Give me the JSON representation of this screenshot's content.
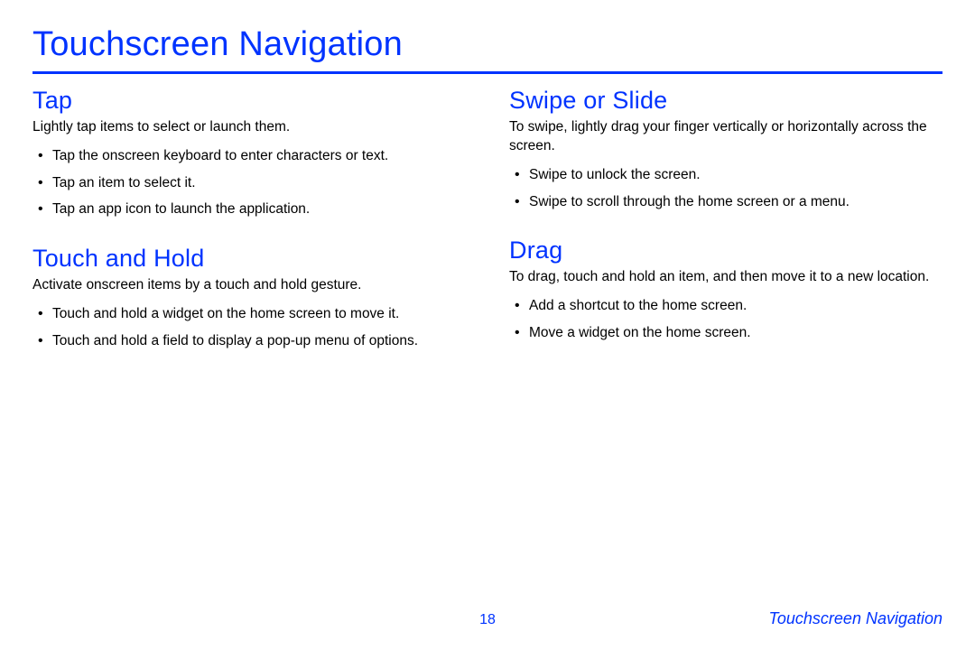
{
  "page": {
    "title": "Touchscreen Navigation",
    "number": "18",
    "footer_label": "Touchscreen Navigation"
  },
  "sections": {
    "tap": {
      "title": "Tap",
      "intro": "Lightly tap items to select or launch them.",
      "bullets": [
        "Tap the onscreen keyboard to enter characters or text.",
        "Tap an item to select it.",
        "Tap an app icon to launch the application."
      ]
    },
    "touch_hold": {
      "title": "Touch and Hold",
      "intro": "Activate onscreen items by a touch and hold gesture.",
      "bullets": [
        "Touch and hold a widget on the home screen to move it.",
        "Touch and hold a field to display a pop-up menu of options."
      ]
    },
    "swipe": {
      "title": "Swipe or Slide",
      "intro": "To swipe, lightly drag your finger vertically or horizontally across the screen.",
      "bullets": [
        "Swipe to unlock the screen.",
        "Swipe to scroll through the home screen or a menu."
      ]
    },
    "drag": {
      "title": "Drag",
      "intro": "To drag, touch and hold an item, and then move it to a new location.",
      "bullets": [
        "Add a shortcut to the home screen.",
        "Move a widget on the home screen."
      ]
    }
  }
}
